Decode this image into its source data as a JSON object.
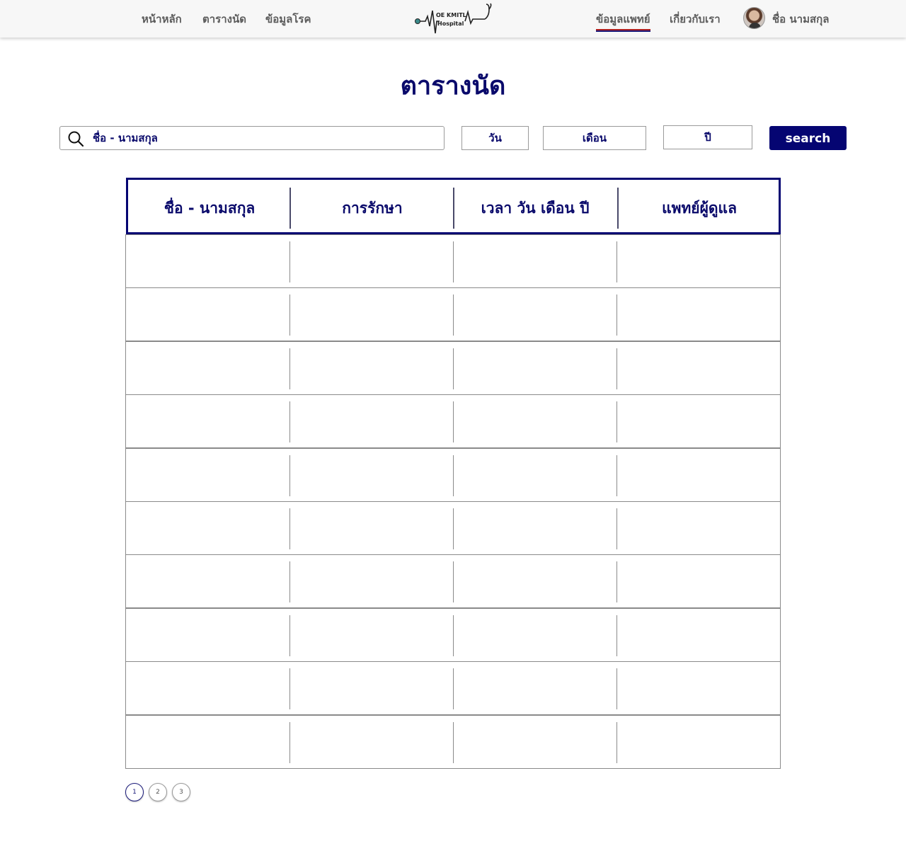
{
  "nav": {
    "left_links": [
      "หน้าหลัก",
      "ตารางนัด",
      "ข้อมูลโรค"
    ],
    "right_links": [
      "ข้อมูลแพทย์",
      "เกี่ยวกับเรา"
    ],
    "active_link": "ข้อมูลแพทย์",
    "logo_line1": "OE KMITL",
    "logo_line2": "Hospital",
    "user_name": "ชื่อ นามสกุล"
  },
  "page": {
    "title": "ตารางนัด"
  },
  "search": {
    "placeholder": "ชื่อ - นามสกุล",
    "day_label": "วัน",
    "month_label": "เดือน",
    "year_label": "ปี",
    "button_label": "search"
  },
  "table": {
    "headers": [
      "ชื่อ - นามสกุล",
      "การรักษา",
      "เวลา วัน เดือน ปี",
      "แพทย์ผู้ดูแล"
    ],
    "rows": [
      [
        "",
        "",
        "",
        ""
      ],
      [
        "",
        "",
        "",
        ""
      ],
      [
        "",
        "",
        "",
        ""
      ],
      [
        "",
        "",
        "",
        ""
      ],
      [
        "",
        "",
        "",
        ""
      ],
      [
        "",
        "",
        "",
        ""
      ],
      [
        "",
        "",
        "",
        ""
      ],
      [
        "",
        "",
        "",
        ""
      ],
      [
        "",
        "",
        "",
        ""
      ],
      [
        "",
        "",
        "",
        ""
      ]
    ]
  },
  "pagination": {
    "pages": [
      "1",
      "2",
      "3"
    ],
    "current": "1"
  },
  "colors": {
    "brand": "#050572",
    "nav_bg": "#f7f7f7",
    "active_underline_top": "#b02020",
    "active_underline_bottom": "#1a1a7a"
  }
}
